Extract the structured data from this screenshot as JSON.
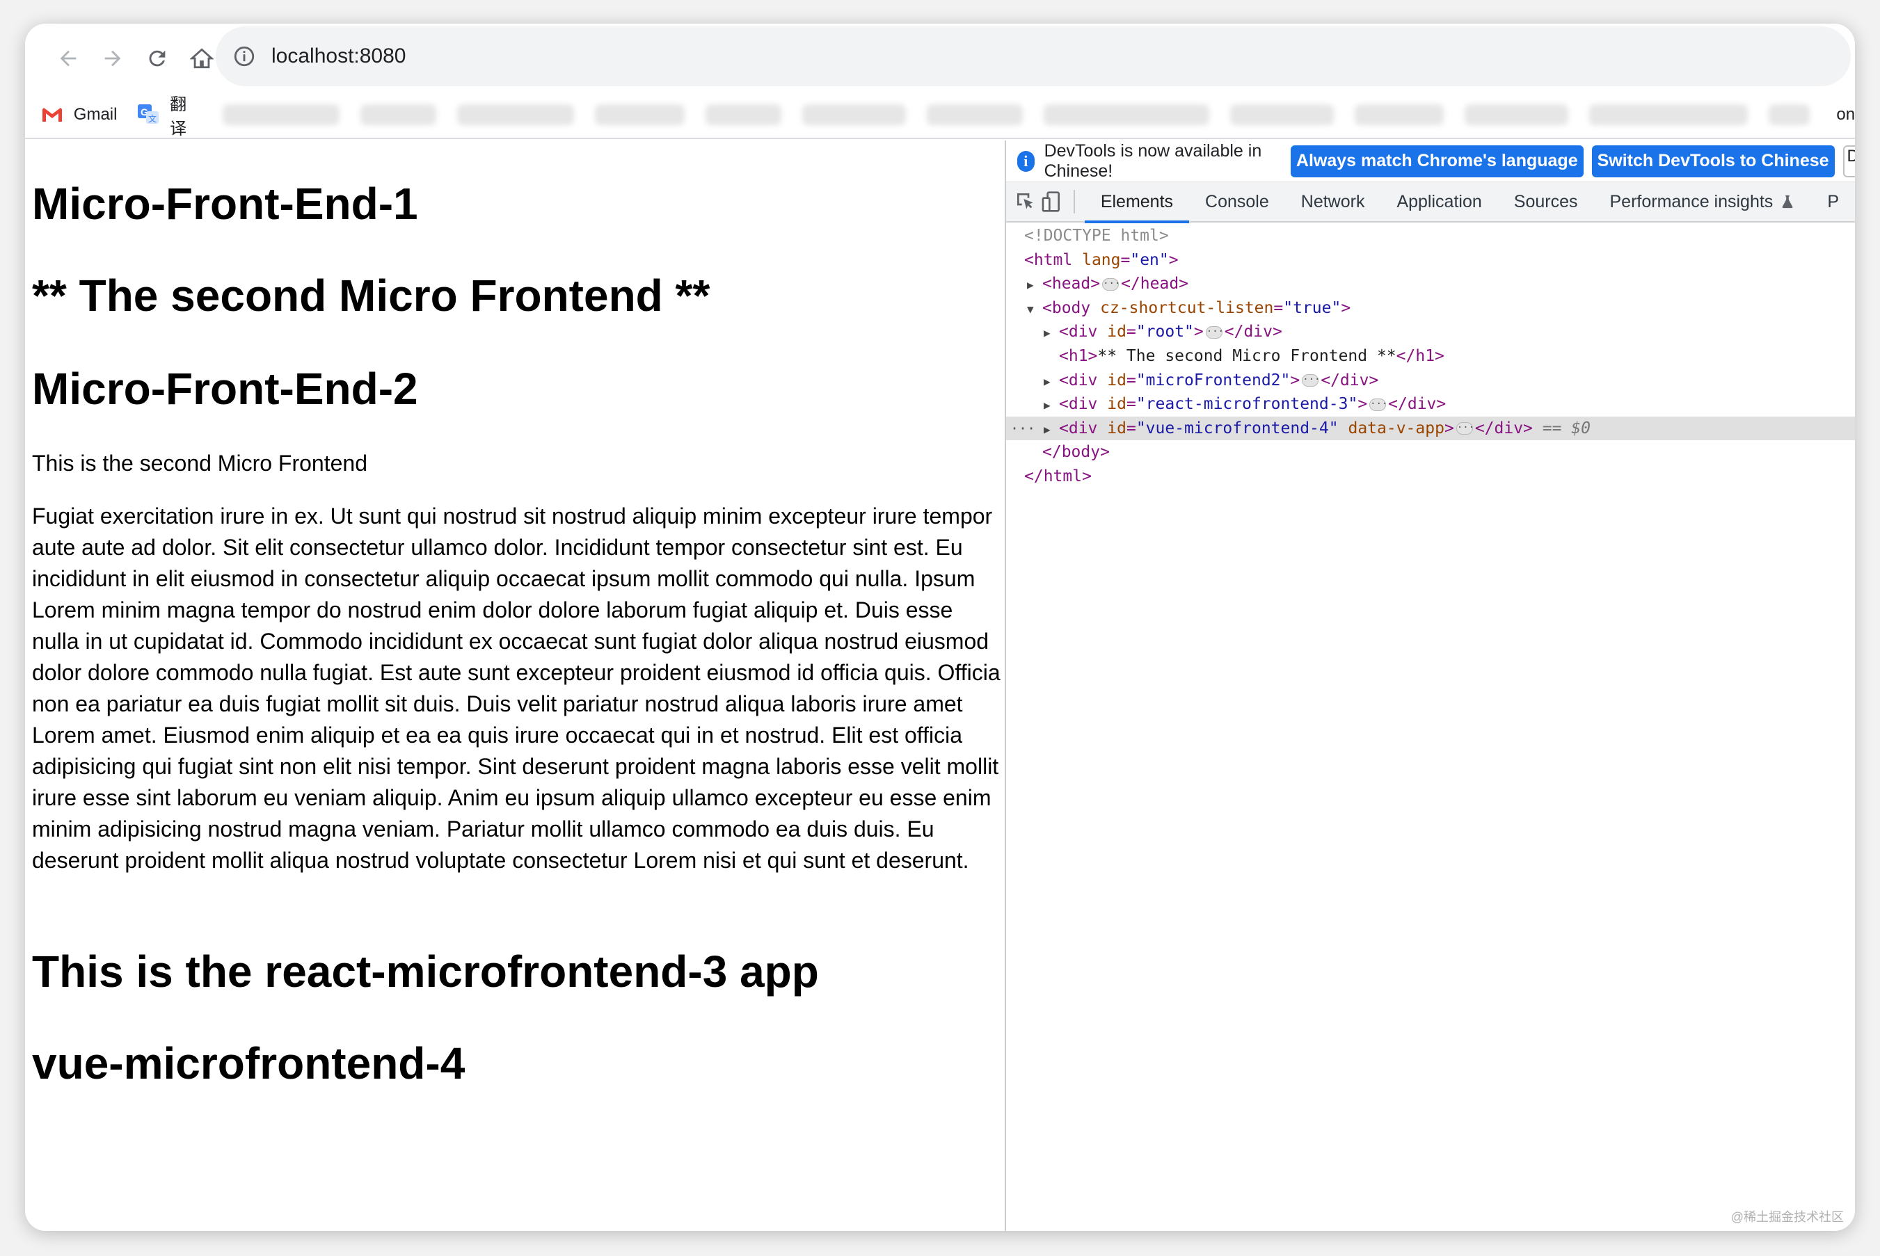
{
  "browser": {
    "url": "localhost:8080",
    "bookmarks": [
      {
        "label": "Gmail",
        "icon": "gmail-icon"
      },
      {
        "label": "翻译",
        "icon": "translate-icon"
      }
    ],
    "bookmarks_overflow": "on"
  },
  "page": {
    "headings": [
      "Micro-Front-End-1",
      "** The second Micro Frontend **",
      "Micro-Front-End-2"
    ],
    "subtitle": "This is the second Micro Frontend",
    "paragraph": "Fugiat exercitation irure in ex. Ut sunt qui nostrud sit nostrud aliquip minim excepteur irure tempor aute aute ad dolor. Sit elit consectetur ullamco dolor. Incididunt tempor consectetur sint est. Eu incididunt in elit eiusmod in consectetur aliquip occaecat ipsum mollit commodo qui nulla. Ipsum Lorem minim magna tempor do nostrud enim dolor dolore laborum fugiat aliquip et. Duis esse nulla in ut cupidatat id. Commodo incididunt ex occaecat sunt fugiat dolor aliqua nostrud eiusmod dolor dolore commodo nulla fugiat. Est aute sunt excepteur proident eiusmod id officia quis. Officia non ea pariatur ea duis fugiat mollit sit duis. Duis velit pariatur nostrud aliqua laboris irure amet Lorem amet. Eiusmod enim aliquip et ea ea quis irure occaecat qui in et nostrud. Elit est officia adipisicing qui fugiat sint non elit nisi tempor. Sint deserunt proident magna laboris esse velit mollit irure esse sint laborum eu veniam aliquip. Anim eu ipsum aliquip ullamco excepteur eu esse enim minim adipisicing nostrud magna veniam. Pariatur mollit ullamco commodo ea duis duis. Eu deserunt proident mollit aliqua nostrud voluptate consectetur Lorem nisi et qui sunt et deserunt.",
    "heading_react": "This is the react-microfrontend-3 app",
    "heading_vue": "vue-microfrontend-4"
  },
  "devtools": {
    "infobar": {
      "message": "DevTools is now available in Chinese!",
      "btn_match": "Always match Chrome's language",
      "btn_switch": "Switch DevTools to Chinese",
      "btn_stub": "D"
    },
    "tabs": [
      "Elements",
      "Console",
      "Network",
      "Application",
      "Sources",
      "Performance insights",
      "P"
    ],
    "active_tab": "Elements",
    "dom": {
      "doctype": "<!DOCTYPE html>",
      "html_open_tag": "<html",
      "html_attr": "lang",
      "html_attr_val": "\"en\"",
      "head_open": "<head>",
      "head_close": "</head>",
      "body_open_tag": "<body",
      "body_attr": "cz-shortcut-listen",
      "body_attr_val": "\"true\"",
      "div_open": "<div",
      "id_attr": "id",
      "root_id": "\"root\"",
      "mf2_id": "\"microFrontend2\"",
      "react_id": "\"react-microfrontend-3\"",
      "vue_id": "\"vue-microfrontend-4\"",
      "vue_extra_attr": "data-v-app",
      "div_close": "</div>",
      "h1_open": "<h1>",
      "h1_text": "** The second Micro Frontend **",
      "h1_close": "</h1>",
      "selected_suffix": "== $0",
      "body_close": "</body>",
      "html_close": "</html>"
    }
  },
  "watermark": "@稀土掘金技术社区",
  "colors": {
    "accent": "#1a73e8",
    "tag": "#881280",
    "attr": "#994500",
    "value": "#1a1aa6"
  }
}
